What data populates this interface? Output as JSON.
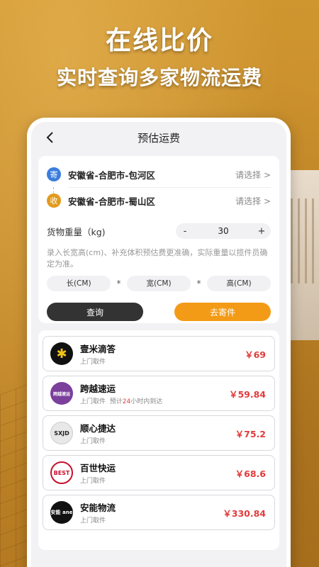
{
  "promo": {
    "headline": "在线比价",
    "subheadline": "实时查询多家物流运费"
  },
  "colors": {
    "background": "#c98e2c",
    "accent_orange": "#f39b16",
    "price_red": "#e23b3b",
    "dark_button": "#333333",
    "send_badge": "#3b7ddd",
    "recv_badge": "#e39a1c"
  },
  "nav": {
    "title": "预估运费",
    "back_icon": "chevron-left-icon"
  },
  "sender": {
    "badge": "寄",
    "address": "安徽省-合肥市-包河区",
    "select_label": "请选择 >"
  },
  "receiver": {
    "badge": "收",
    "address": "安徽省-合肥市-蜀山区",
    "select_label": "请选择 >"
  },
  "weight": {
    "label": "货物重量（kg)",
    "minus": "-",
    "value": "30",
    "plus": "+"
  },
  "hint": "录入长宽高(cm)、补充体积预估费更准确，实际重量以揽件员确定为准。",
  "dimensions": {
    "length_placeholder": "长(CM)",
    "width_placeholder": "宽(CM)",
    "height_placeholder": "高(CM)",
    "separator": "*"
  },
  "buttons": {
    "query": "查询",
    "send": "去寄件"
  },
  "carriers": [
    {
      "name": "壹米滴答",
      "service": "上门取件",
      "eta_prefix": "",
      "eta_highlight": "",
      "eta_suffix": "",
      "price": "￥69",
      "logo_text": "✱",
      "logo_icon": "yimidida-logo-icon"
    },
    {
      "name": "跨越速运",
      "service": "上门取件",
      "eta_prefix": "预计",
      "eta_highlight": "24",
      "eta_suffix": "小时内到达",
      "price": "￥59.84",
      "logo_text": "跨越速运",
      "logo_icon": "kuayue-logo-icon"
    },
    {
      "name": "顺心捷达",
      "service": "上门取件",
      "eta_prefix": "",
      "eta_highlight": "",
      "eta_suffix": "",
      "price": "￥75.2",
      "logo_text": "SXJD",
      "logo_icon": "shunxin-logo-icon"
    },
    {
      "name": "百世快运",
      "service": "上门取件",
      "eta_prefix": "",
      "eta_highlight": "",
      "eta_suffix": "",
      "price": "￥68.6",
      "logo_text": "BEST",
      "logo_icon": "best-logo-icon"
    },
    {
      "name": "安能物流",
      "service": "上门取件",
      "eta_prefix": "",
      "eta_highlight": "",
      "eta_suffix": "",
      "price": "￥330.84",
      "logo_text": "安能 ane",
      "logo_icon": "ane-logo-icon"
    }
  ]
}
